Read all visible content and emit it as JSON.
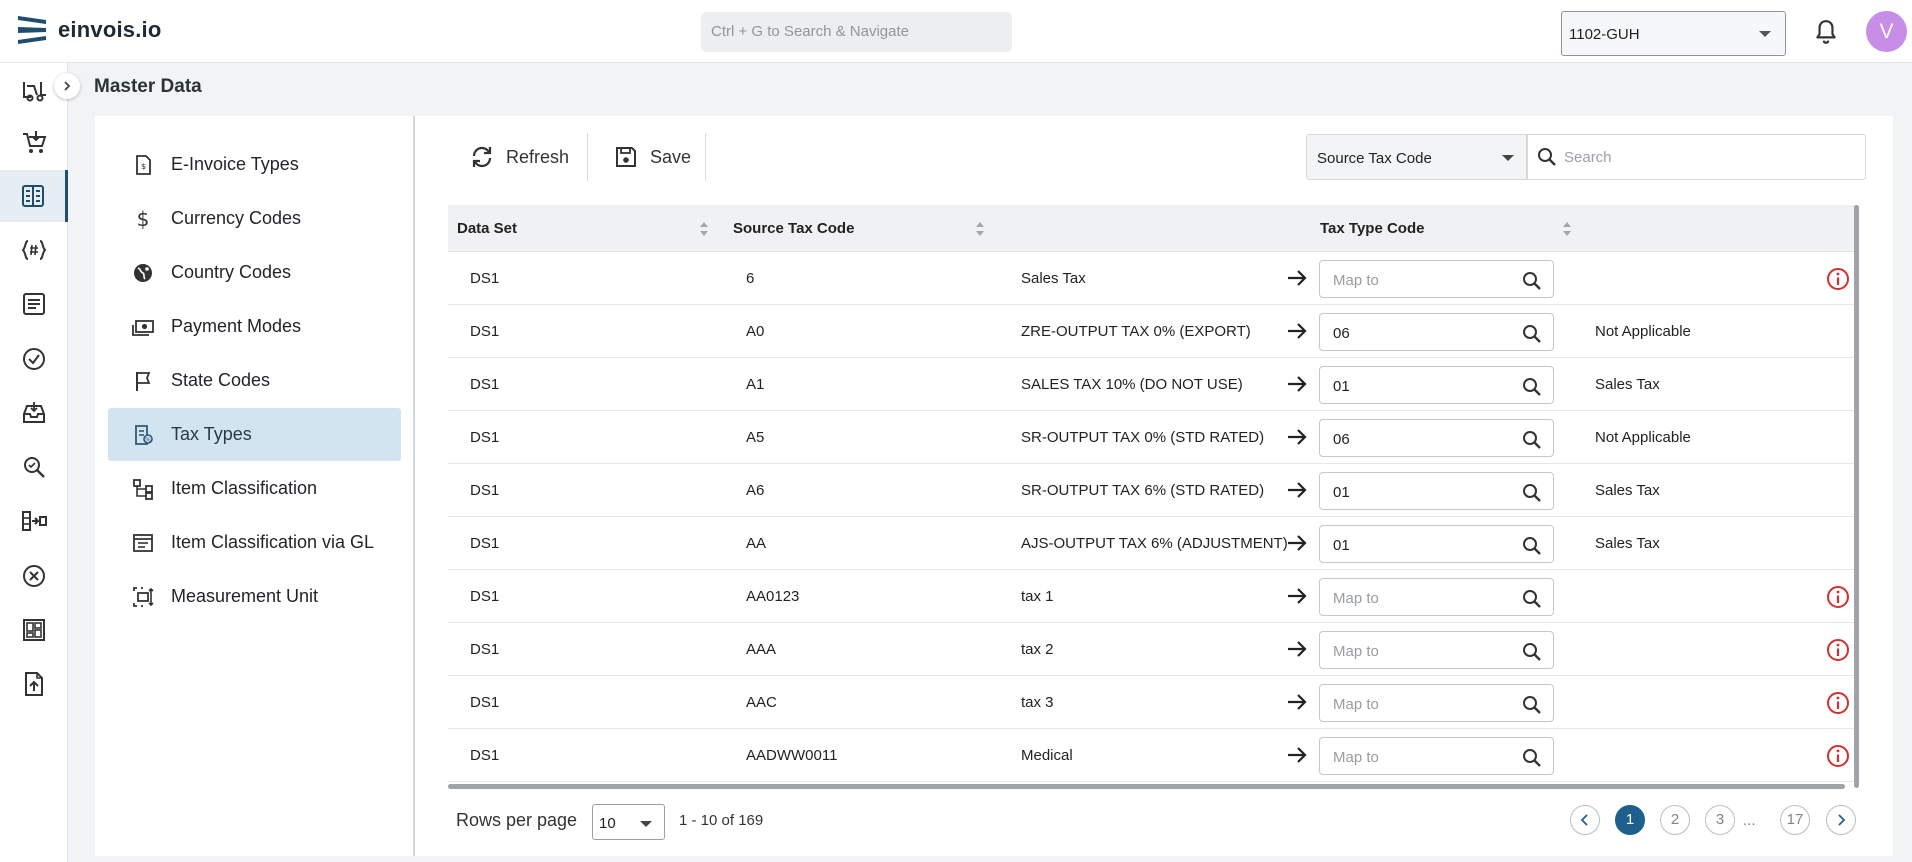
{
  "app": {
    "brand": "einvois.io",
    "brand_color": "#1f4d6e"
  },
  "header": {
    "search_placeholder": "Ctrl + G to Search & Navigate",
    "company": "1102-GUH",
    "avatar_letter": "V",
    "avatar_color": "#c88de6"
  },
  "rail": {
    "items": [
      "forklift-icon",
      "cart-icon",
      "master-data-icon",
      "code-icon",
      "list-icon",
      "check-circle-icon",
      "inbox-icon",
      "search-doc-icon",
      "flow-icon",
      "cancel-circle-icon",
      "dashboard-icon",
      "upload-file-icon"
    ],
    "active": "master-data-icon"
  },
  "page": {
    "title": "Master Data"
  },
  "nav": {
    "items": [
      {
        "label": "E-Invoice Types",
        "icon": "invoice-icon"
      },
      {
        "label": "Currency Codes",
        "icon": "dollar-icon"
      },
      {
        "label": "Country Codes",
        "icon": "globe-icon"
      },
      {
        "label": "Payment Modes",
        "icon": "money-icon"
      },
      {
        "label": "State Codes",
        "icon": "flag-icon"
      },
      {
        "label": "Tax Types",
        "icon": "tax-icon",
        "active": true
      },
      {
        "label": "Item Classification",
        "icon": "hierarchy-icon"
      },
      {
        "label": "Item Classification via GL",
        "icon": "ledger-icon"
      },
      {
        "label": "Measurement Unit",
        "icon": "measure-icon"
      }
    ]
  },
  "toolbar": {
    "refresh_label": "Refresh",
    "save_label": "Save",
    "filter_field": "Source Tax Code",
    "search_placeholder": "Search"
  },
  "table": {
    "columns": [
      "Data Set",
      "Source Tax Code",
      "Tax Type Code"
    ],
    "map_placeholder": "Map to",
    "rows": [
      {
        "data_set": "DS1",
        "code": "6",
        "desc": "Sales Tax",
        "mapped": "",
        "type_name": "",
        "warning": true
      },
      {
        "data_set": "DS1",
        "code": "A0",
        "desc": "ZRE-OUTPUT TAX 0% (EXPORT)",
        "mapped": "06",
        "type_name": "Not Applicable",
        "warning": false
      },
      {
        "data_set": "DS1",
        "code": "A1",
        "desc": "SALES TAX 10% (DO NOT USE)",
        "mapped": "01",
        "type_name": "Sales Tax",
        "warning": false
      },
      {
        "data_set": "DS1",
        "code": "A5",
        "desc": "SR-OUTPUT TAX 0% (STD RATED)",
        "mapped": "06",
        "type_name": "Not Applicable",
        "warning": false
      },
      {
        "data_set": "DS1",
        "code": "A6",
        "desc": "SR-OUTPUT TAX 6% (STD RATED)",
        "mapped": "01",
        "type_name": "Sales Tax",
        "warning": false
      },
      {
        "data_set": "DS1",
        "code": "AA",
        "desc": "AJS-OUTPUT TAX 6% (ADJUSTMENT)",
        "mapped": "01",
        "type_name": "Sales Tax",
        "warning": false
      },
      {
        "data_set": "DS1",
        "code": "AA0123",
        "desc": "tax 1",
        "mapped": "",
        "type_name": "",
        "warning": true
      },
      {
        "data_set": "DS1",
        "code": "AAA",
        "desc": "tax 2",
        "mapped": "",
        "type_name": "",
        "warning": true
      },
      {
        "data_set": "DS1",
        "code": "AAC",
        "desc": "tax 3",
        "mapped": "",
        "type_name": "",
        "warning": true
      },
      {
        "data_set": "DS1",
        "code": "AADWW0011",
        "desc": "Medical",
        "mapped": "",
        "type_name": "",
        "warning": true
      }
    ]
  },
  "pagination": {
    "rows_label": "Rows per page",
    "rows_per_page": "10",
    "range": "1 - 10 of 169",
    "pages": [
      "1",
      "2",
      "3",
      "17"
    ],
    "ellipsis": "...",
    "current": "1"
  },
  "colors": {
    "warning": "#d32f2f",
    "active_nav": "#d2e4ef",
    "page_active": "#1e5f8e"
  }
}
